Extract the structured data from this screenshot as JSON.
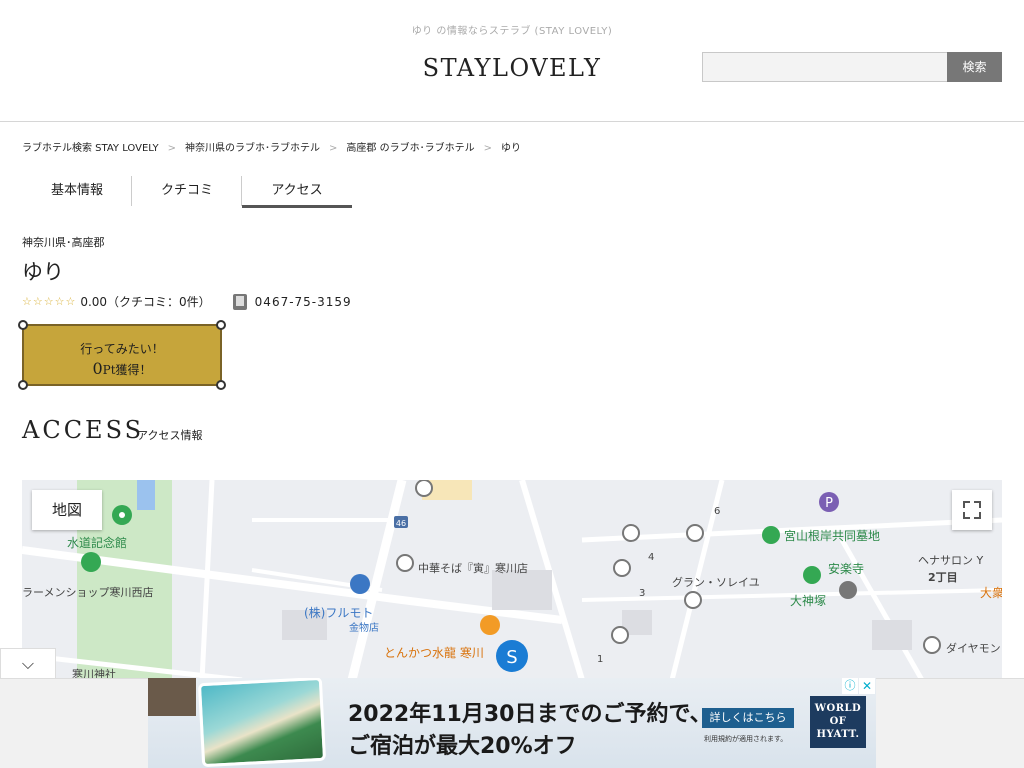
{
  "header": {
    "tagline": "ゆり の情報ならステラブ (STAY LOVELY)",
    "logo_text": "STAYLOVELY",
    "search_button": "検索",
    "search_placeholder": ""
  },
  "breadcrumb": [
    "ラブホテル検索 STAY LOVELY",
    "神奈川県のラブホ･ラブホテル",
    "高座郡 のラブホ･ラブホテル",
    "ゆり"
  ],
  "breadcrumb_sep": ">",
  "tabs": [
    {
      "label": "基本情報",
      "active": false
    },
    {
      "label": "クチコミ",
      "active": false
    },
    {
      "label": "アクセス",
      "active": true
    }
  ],
  "hotel": {
    "area": "神奈川県･高座郡",
    "name": "ゆり",
    "stars": "☆☆☆☆☆",
    "rating_text": "0.00（クチコミ：0件）",
    "phone": "0467-75-3159"
  },
  "want_button": {
    "line1": "行ってみたい！",
    "points": "0",
    "points_suffix": "Pt獲得！"
  },
  "access": {
    "title": "ACCESS",
    "subtitle": "アクセス情報"
  },
  "map": {
    "type_label": "地図",
    "labels": [
      "水道記念館",
      "ラーメンショップ寒川西店",
      "中華そば『寅』寒川店",
      "(株)フルモト",
      "金物店",
      "とんかつ水龍 寒川",
      "寒川神社",
      "グラン・ソレイユ",
      "宮山根岸共同墓地",
      "安楽寺",
      "大神塚",
      "ヘナサロン Y",
      "2丁目",
      "大衆",
      "ダイヤモン",
      "46",
      "6",
      "4",
      "3",
      "1"
    ]
  },
  "ad": {
    "line1": "2022年11月30日までのご予約で、",
    "line2": "ご宿泊が最大20%オフ",
    "cta": "詳しくはこちら",
    "note": "利用規約が適用されます。",
    "logo_line1": "WORLD",
    "logo_line2": "OF",
    "logo_line3": "HYATT.",
    "info_icon": "ⓘ",
    "close_icon": "✕"
  },
  "collapse_icon": "⌵"
}
